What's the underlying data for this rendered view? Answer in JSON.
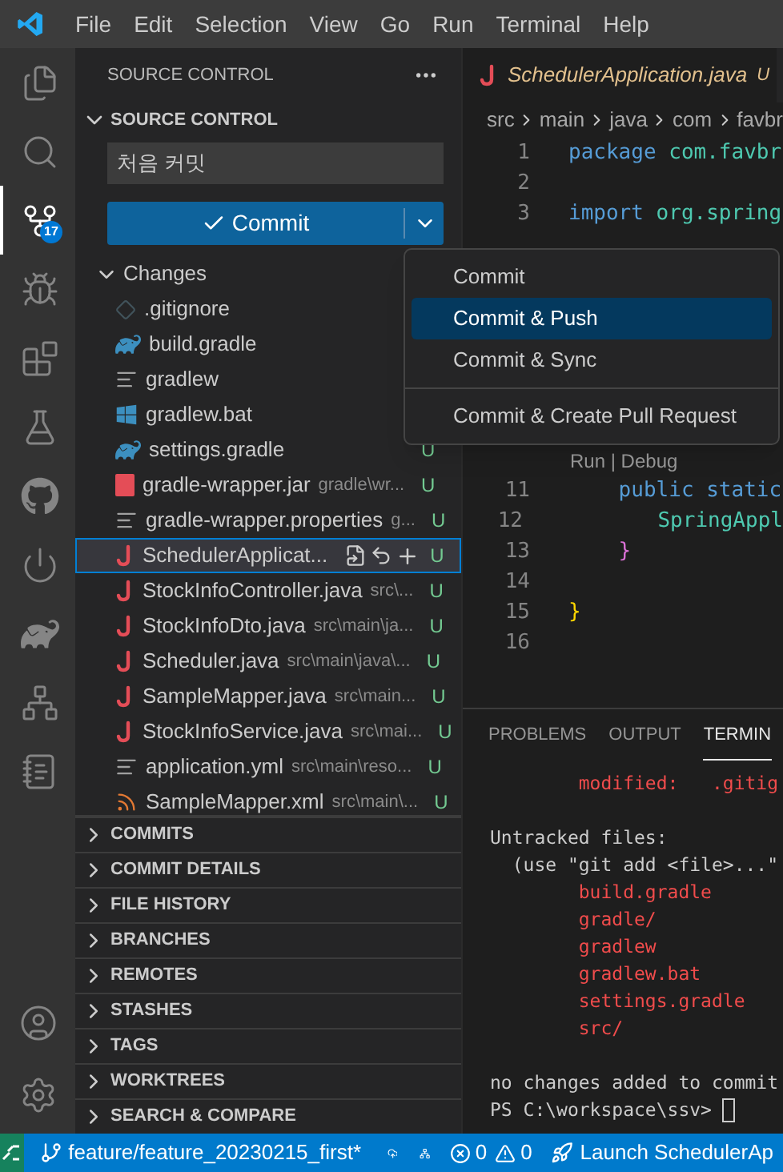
{
  "menu_bar": [
    "File",
    "Edit",
    "Selection",
    "View",
    "Go",
    "Run",
    "Terminal",
    "Help"
  ],
  "activity_bar": [
    {
      "kind": "files",
      "selected": false
    },
    {
      "kind": "search",
      "selected": false
    },
    {
      "kind": "scm",
      "selected": true,
      "badge": "17"
    },
    {
      "kind": "debug",
      "selected": false
    },
    {
      "kind": "extensions",
      "selected": false
    },
    {
      "kind": "testing",
      "selected": false
    },
    {
      "kind": "github",
      "selected": false
    },
    {
      "kind": "power",
      "selected": false
    },
    {
      "kind": "gradle",
      "selected": false
    },
    {
      "kind": "graph",
      "selected": false
    },
    {
      "kind": "notebook",
      "selected": false
    }
  ],
  "activity_bottom": [
    {
      "kind": "account"
    },
    {
      "kind": "settings"
    }
  ],
  "sidebar": {
    "title": "SOURCE CONTROL",
    "section": "SOURCE CONTROL",
    "message": "처음 커밋",
    "commit_button": "Commit",
    "changes": {
      "label": "Changes",
      "expanded": true,
      "files": [
        {
          "kind": "gitignore",
          "name": ".gitignore",
          "selected": false
        },
        {
          "kind": "gradle",
          "name": "build.gradle",
          "selected": false
        },
        {
          "kind": "lines",
          "name": "gradlew",
          "selected": false
        },
        {
          "kind": "windows",
          "name": "gradlew.bat",
          "selected": false
        },
        {
          "kind": "gradle",
          "name": "settings.gradle",
          "status": "U",
          "selected": false
        },
        {
          "kind": "jar",
          "name": "gradle-wrapper.jar",
          "description": "gradle\\wr...",
          "status": "U",
          "selected": false
        },
        {
          "kind": "lines",
          "name": "gradle-wrapper.properties",
          "description": "g...",
          "status": "U",
          "selected": false
        },
        {
          "kind": "java",
          "name": "SchedulerApplicat...",
          "status": "U",
          "selected": true
        },
        {
          "kind": "java",
          "name": "StockInfoController.java",
          "description": "src\\...",
          "status": "U",
          "selected": false
        },
        {
          "kind": "java",
          "name": "StockInfoDto.java",
          "description": "src\\main\\ja...",
          "status": "U",
          "selected": false
        },
        {
          "kind": "java",
          "name": "Scheduler.java",
          "description": "src\\main\\java\\...",
          "status": "U",
          "selected": false
        },
        {
          "kind": "java",
          "name": "SampleMapper.java",
          "description": "src\\main...",
          "status": "U",
          "selected": false
        },
        {
          "kind": "java",
          "name": "StockInfoService.java",
          "description": "src\\mai...",
          "status": "U",
          "selected": false
        },
        {
          "kind": "lines",
          "name": "application.yml",
          "description": "src\\main\\reso...",
          "status": "U",
          "selected": false
        },
        {
          "kind": "xml",
          "name": "SampleMapper.xml",
          "description": "src\\main\\...",
          "status": "U",
          "selected": false
        }
      ]
    },
    "sections": [
      {
        "label": "COMMITS",
        "expanded": false
      },
      {
        "label": "COMMIT DETAILS",
        "expanded": false
      },
      {
        "label": "FILE HISTORY",
        "expanded": false
      },
      {
        "label": "BRANCHES",
        "expanded": false
      },
      {
        "label": "REMOTES",
        "expanded": false
      },
      {
        "label": "STASHES",
        "expanded": false
      },
      {
        "label": "TAGS",
        "expanded": false
      },
      {
        "label": "WORKTREES",
        "expanded": false
      },
      {
        "label": "SEARCH & COMPARE",
        "expanded": false
      }
    ]
  },
  "commit_menu": [
    {
      "label": "Commit",
      "selected": false
    },
    {
      "label": "Commit & Push",
      "selected": true
    },
    {
      "label": "Commit & Sync",
      "selected": false
    },
    {
      "label": "Commit & Create Pull Request",
      "selected": false,
      "separated": true
    }
  ],
  "editor": {
    "tab": {
      "name": "SchedulerApplication.java",
      "status": "U"
    },
    "breadcrumb": [
      "src",
      "main",
      "java",
      "com",
      "favbr"
    ],
    "lines": [
      {
        "number": "1",
        "tokens": [
          {
            "kind": "keyword",
            "text": "package"
          },
          {
            "kind": "type",
            "text": " com.favbr"
          }
        ]
      },
      {
        "number": "2"
      },
      {
        "number": "3",
        "tokens": [
          {
            "kind": "keyword",
            "text": "import"
          },
          {
            "kind": "type",
            "text": " org.spring"
          }
        ]
      },
      {
        "kind": "hidden"
      },
      {
        "kind": "lens",
        "text": "Run | Debug"
      },
      {
        "number": "11",
        "tokens": [
          {
            "kind": "keyword",
            "text": "    public static"
          }
        ]
      },
      {
        "number": "12",
        "tokens": [
          {
            "kind": "type",
            "text": "        SpringAppl"
          }
        ]
      },
      {
        "number": "13",
        "tokens": [
          {
            "kind": "bracket2",
            "text": "    }"
          }
        ]
      },
      {
        "number": "14"
      },
      {
        "number": "15",
        "tokens": [
          {
            "kind": "bracket1",
            "text": "}"
          }
        ]
      },
      {
        "number": "16"
      }
    ]
  },
  "panel": {
    "tabs": [
      {
        "label": "PROBLEMS",
        "selected": false
      },
      {
        "label": "OUTPUT",
        "selected": false
      },
      {
        "label": "TERMIN",
        "selected": true
      }
    ],
    "terminal": [
      {
        "kind": "red",
        "text": "        modified:   .gitig"
      },
      {
        "kind": "blank"
      },
      {
        "kind": "plain",
        "text": "Untracked files:"
      },
      {
        "kind": "plain",
        "text": "  (use \"git add <file>...\""
      },
      {
        "kind": "red",
        "text": "        build.gradle"
      },
      {
        "kind": "red",
        "text": "        gradle/"
      },
      {
        "kind": "red",
        "text": "        gradlew"
      },
      {
        "kind": "red",
        "text": "        gradlew.bat"
      },
      {
        "kind": "red",
        "text": "        settings.gradle"
      },
      {
        "kind": "red",
        "text": "        src/"
      },
      {
        "kind": "blank"
      },
      {
        "kind": "plain",
        "text": "no changes added to commit"
      },
      {
        "kind": "prompt",
        "text": "PS C:\\workspace\\ssv> "
      }
    ]
  },
  "status_bar": {
    "branch": "feature/feature_20230215_first*",
    "errors": "0",
    "warnings": "0",
    "launch": "Launch SchedulerAp"
  }
}
